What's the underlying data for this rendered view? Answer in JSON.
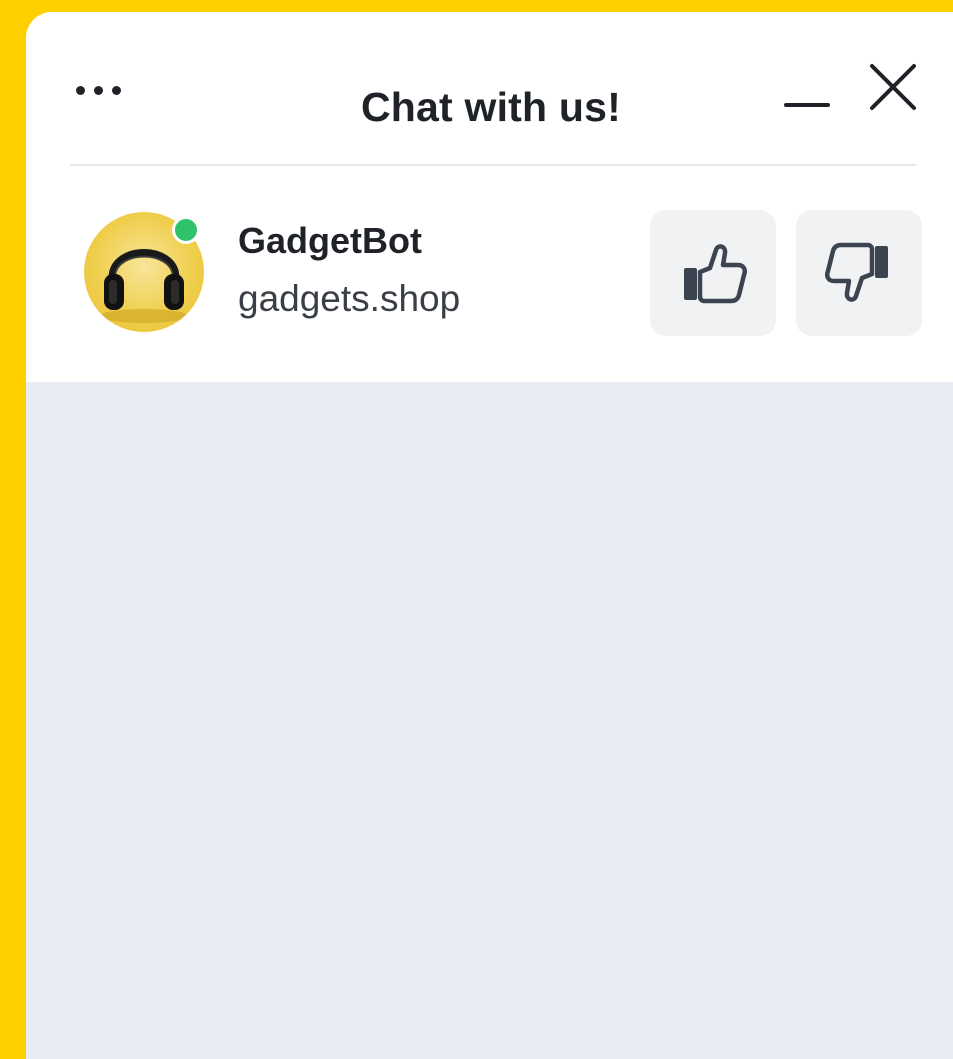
{
  "header": {
    "title": "Chat with us!",
    "more_icon": "more-horizontal-icon",
    "minimize_icon": "minimize-icon",
    "close_icon": "close-icon"
  },
  "agent": {
    "name": "GadgetBot",
    "domain": "gadgets.shop",
    "avatar_icon": "headphones-icon",
    "status": "online",
    "status_color": "#2fc26b"
  },
  "feedback": {
    "thumbs_up_icon": "thumbs-up-icon",
    "thumbs_down_icon": "thumbs-down-icon"
  },
  "colors": {
    "page_background": "#FFD000",
    "window_background": "#ffffff",
    "messages_background": "#e9ecf2",
    "text_primary": "#1f2328",
    "button_background": "#f1f2f4",
    "icon_color": "#3b4450"
  }
}
